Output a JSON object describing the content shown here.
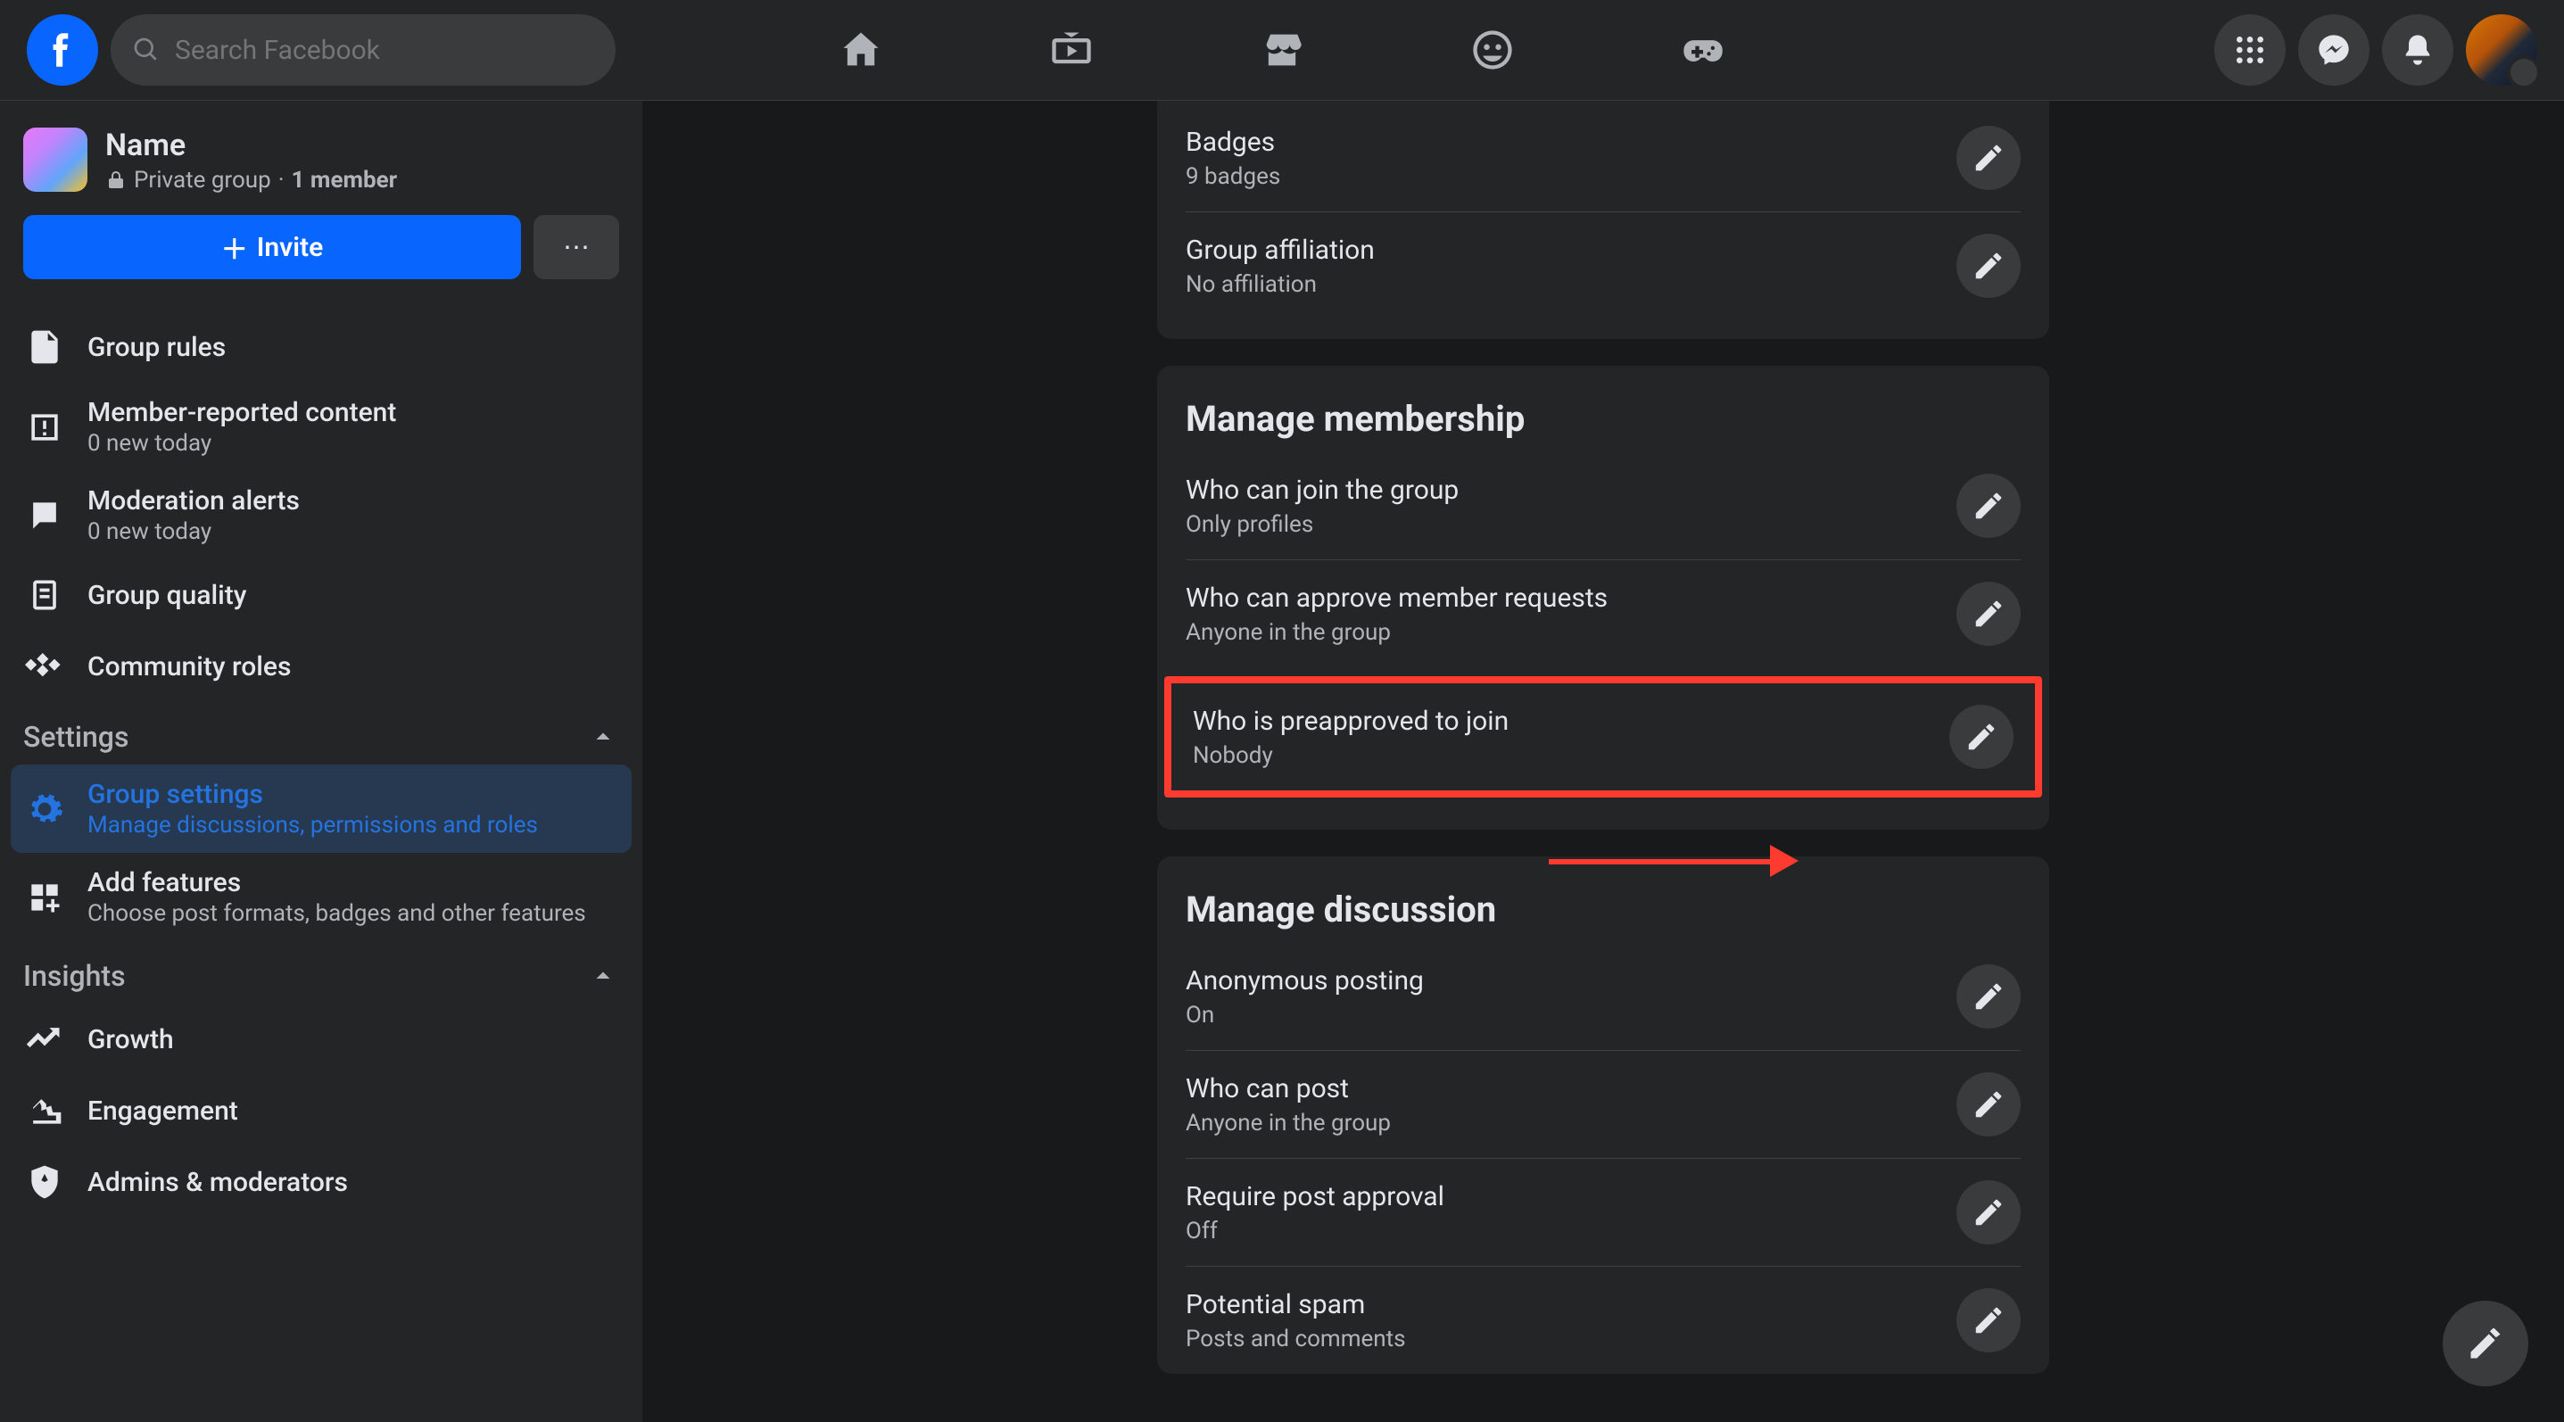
{
  "search_placeholder": "Search Facebook",
  "group": {
    "name": "Name",
    "privacy": "Private group",
    "members": "1 member",
    "invite_label": "Invite"
  },
  "sidebar": {
    "items": [
      {
        "title": "Group rules"
      },
      {
        "title": "Member-reported content",
        "sub": "0 new today"
      },
      {
        "title": "Moderation alerts",
        "sub": "0 new today"
      },
      {
        "title": "Group quality"
      },
      {
        "title": "Community roles"
      }
    ],
    "settings_label": "Settings",
    "settings_items": [
      {
        "title": "Group settings",
        "sub": "Manage discussions, permissions and roles"
      },
      {
        "title": "Add features",
        "sub": "Choose post formats, badges and other features"
      }
    ],
    "insights_label": "Insights",
    "insights_items": [
      {
        "title": "Growth"
      },
      {
        "title": "Engagement"
      },
      {
        "title": "Admins & moderators"
      }
    ]
  },
  "cards": {
    "top": {
      "rows": [
        {
          "title": "Badges",
          "sub": "9 badges"
        },
        {
          "title": "Group affiliation",
          "sub": "No affiliation"
        }
      ]
    },
    "membership": {
      "title": "Manage membership",
      "rows": [
        {
          "title": "Who can join the group",
          "sub": "Only profiles"
        },
        {
          "title": "Who can approve member requests",
          "sub": "Anyone in the group"
        },
        {
          "title": "Who is preapproved to join",
          "sub": "Nobody"
        }
      ]
    },
    "discussion": {
      "title": "Manage discussion",
      "rows": [
        {
          "title": "Anonymous posting",
          "sub": "On"
        },
        {
          "title": "Who can post",
          "sub": "Anyone in the group"
        },
        {
          "title": "Require post approval",
          "sub": "Off"
        },
        {
          "title": "Potential spam",
          "sub": "Posts and comments"
        }
      ]
    }
  },
  "annotation": {
    "highlight_color": "#ff3b30"
  }
}
